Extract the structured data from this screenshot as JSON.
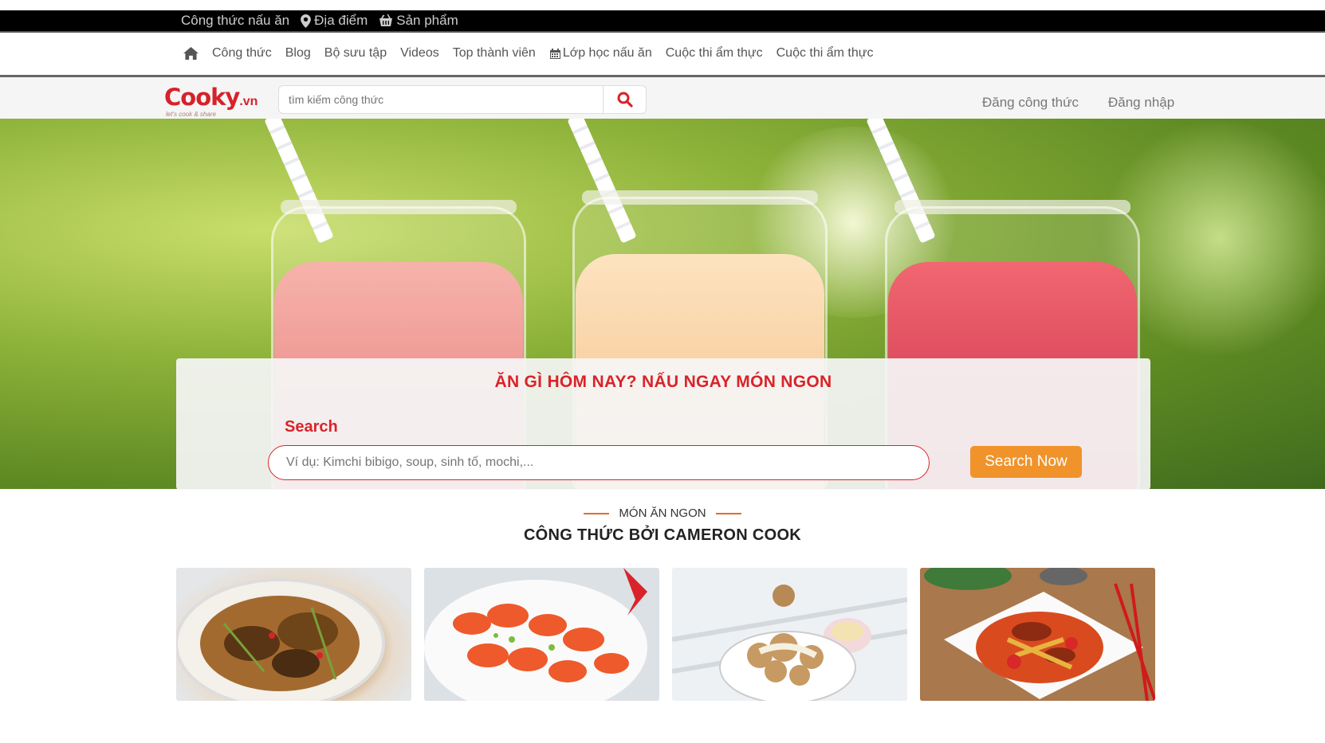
{
  "topbar": {
    "items": [
      {
        "label": "Công thức nấu ăn",
        "icon": ""
      },
      {
        "label": "Địa điểm",
        "icon": "map-marker-icon"
      },
      {
        "label": "Sản phẩm",
        "icon": "basket-icon"
      }
    ]
  },
  "nav": {
    "home_icon": "home-icon",
    "items": [
      {
        "label": "Công thức"
      },
      {
        "label": "Blog"
      },
      {
        "label": "Bộ sưu tập"
      },
      {
        "label": "Videos"
      },
      {
        "label": "Top thành viên"
      },
      {
        "label": "Lớp học nấu ăn",
        "icon": "calendar-icon"
      },
      {
        "label": "Cuộc thi ẩm thực"
      },
      {
        "label": "Cuộc thi ẩm thực"
      }
    ]
  },
  "header": {
    "logo_word": "Cooky",
    "logo_suffix": ".vn",
    "logo_tagline": "let's cook & share",
    "search_placeholder": "tìm kiếm công thức",
    "post_recipe": "Đăng công thức",
    "login": "Đăng nhập"
  },
  "hero": {
    "title": "ĂN GÌ HÔM NAY? NẤU NGAY MÓN NGON",
    "search_label": "Search",
    "search_placeholder": "Ví dụ: Kimchi bibigo, soup, sinh tố, mochi,...",
    "search_button": "Search Now"
  },
  "section": {
    "kicker": "MÓN ĂN NGON",
    "headline": "CÔNG THỨC BỞI CAMERON COOK"
  },
  "colors": {
    "brand_red": "#d9232a",
    "accent_orange": "#f0932b"
  }
}
